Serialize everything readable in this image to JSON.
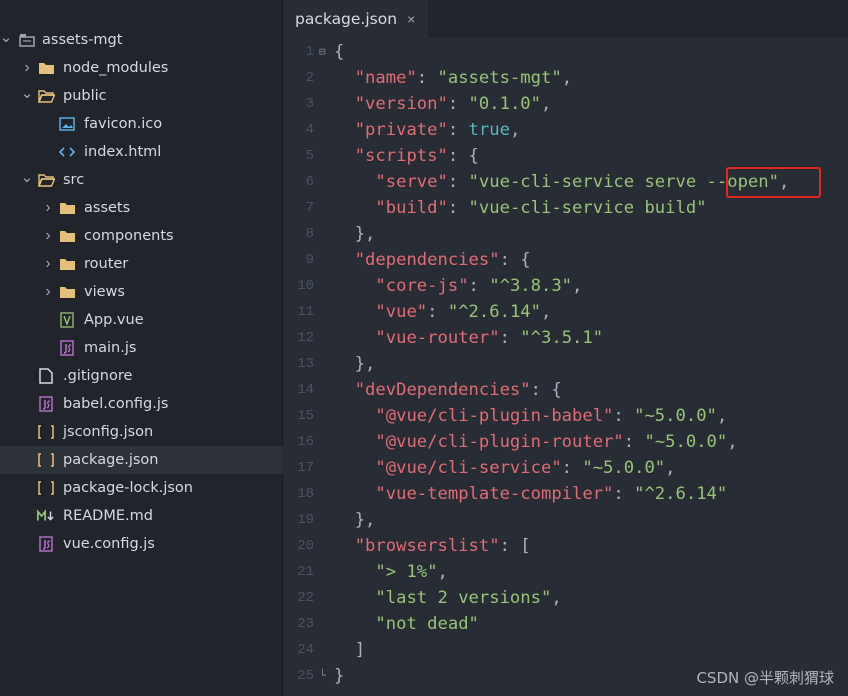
{
  "sidebar": {
    "items": [
      {
        "label": "assets-mgt",
        "icon": "project-root-icon",
        "chevron": "chevron-down-icon",
        "depth": 0,
        "type": "root"
      },
      {
        "label": "node_modules",
        "icon": "folder-icon",
        "chevron": "chevron-right-icon",
        "depth": 1,
        "type": "folder"
      },
      {
        "label": "public",
        "icon": "folder-open-icon",
        "chevron": "chevron-down-icon",
        "depth": 1,
        "type": "folder"
      },
      {
        "label": "favicon.ico",
        "icon": "image-file-icon",
        "depth": 2,
        "type": "file"
      },
      {
        "label": "index.html",
        "icon": "html-file-icon",
        "depth": 2,
        "type": "file"
      },
      {
        "label": "src",
        "icon": "folder-open-icon",
        "chevron": "chevron-down-icon",
        "depth": 1,
        "type": "folder"
      },
      {
        "label": "assets",
        "icon": "folder-icon",
        "chevron": "chevron-right-icon",
        "depth": 2,
        "type": "folder"
      },
      {
        "label": "components",
        "icon": "folder-icon",
        "chevron": "chevron-right-icon",
        "depth": 2,
        "type": "folder"
      },
      {
        "label": "router",
        "icon": "folder-icon",
        "chevron": "chevron-right-icon",
        "depth": 2,
        "type": "folder"
      },
      {
        "label": "views",
        "icon": "folder-icon",
        "chevron": "chevron-right-icon",
        "depth": 2,
        "type": "folder"
      },
      {
        "label": "App.vue",
        "icon": "vue-file-icon",
        "depth": 2,
        "type": "file"
      },
      {
        "label": "main.js",
        "icon": "js-file-icon",
        "depth": 2,
        "type": "file"
      },
      {
        "label": ".gitignore",
        "icon": "plain-file-icon",
        "depth": 1,
        "type": "file"
      },
      {
        "label": "babel.config.js",
        "icon": "js-file-icon",
        "depth": 1,
        "type": "file"
      },
      {
        "label": "jsconfig.json",
        "icon": "json-file-icon",
        "depth": 1,
        "type": "file"
      },
      {
        "label": "package.json",
        "icon": "json-file-icon",
        "depth": 1,
        "type": "file",
        "selected": true
      },
      {
        "label": "package-lock.json",
        "icon": "json-file-icon",
        "depth": 1,
        "type": "file"
      },
      {
        "label": "README.md",
        "icon": "markdown-file-icon",
        "depth": 1,
        "type": "file"
      },
      {
        "label": "vue.config.js",
        "icon": "js-file-icon",
        "depth": 1,
        "type": "file"
      }
    ]
  },
  "tab": {
    "title": "package.json",
    "close_glyph": "×"
  },
  "editor": {
    "lines": [
      {
        "n": "1",
        "fold": "⊟",
        "tokens": [
          [
            "p",
            "{"
          ]
        ]
      },
      {
        "n": "2",
        "tokens": [
          [
            "p",
            "  "
          ],
          [
            "k",
            "\"name\""
          ],
          [
            "p",
            ": "
          ],
          [
            "s",
            "\"assets-mgt\""
          ],
          [
            "p",
            ","
          ]
        ]
      },
      {
        "n": "3",
        "tokens": [
          [
            "p",
            "  "
          ],
          [
            "k",
            "\"version\""
          ],
          [
            "p",
            ": "
          ],
          [
            "s",
            "\"0.1.0\""
          ],
          [
            "p",
            ","
          ]
        ]
      },
      {
        "n": "4",
        "tokens": [
          [
            "p",
            "  "
          ],
          [
            "k",
            "\"private\""
          ],
          [
            "p",
            ": "
          ],
          [
            "b",
            "true"
          ],
          [
            "p",
            ","
          ]
        ]
      },
      {
        "n": "5",
        "tokens": [
          [
            "p",
            "  "
          ],
          [
            "k",
            "\"scripts\""
          ],
          [
            "p",
            ": {"
          ]
        ]
      },
      {
        "n": "6",
        "tokens": [
          [
            "p",
            "    "
          ],
          [
            "k",
            "\"serve\""
          ],
          [
            "p",
            ": "
          ],
          [
            "s",
            "\"vue-cli-service serve --open\""
          ],
          [
            "p",
            ","
          ]
        ]
      },
      {
        "n": "7",
        "tokens": [
          [
            "p",
            "    "
          ],
          [
            "k",
            "\"build\""
          ],
          [
            "p",
            ": "
          ],
          [
            "s",
            "\"vue-cli-service build\""
          ]
        ]
      },
      {
        "n": "8",
        "tokens": [
          [
            "p",
            "  },"
          ]
        ]
      },
      {
        "n": "9",
        "tokens": [
          [
            "p",
            "  "
          ],
          [
            "k",
            "\"dependencies\""
          ],
          [
            "p",
            ": {"
          ]
        ]
      },
      {
        "n": "10",
        "tokens": [
          [
            "p",
            "    "
          ],
          [
            "k",
            "\"core-js\""
          ],
          [
            "p",
            ": "
          ],
          [
            "s",
            "\"^3.8.3\""
          ],
          [
            "p",
            ","
          ]
        ]
      },
      {
        "n": "11",
        "tokens": [
          [
            "p",
            "    "
          ],
          [
            "k",
            "\"vue\""
          ],
          [
            "p",
            ": "
          ],
          [
            "s",
            "\"^2.6.14\""
          ],
          [
            "p",
            ","
          ]
        ]
      },
      {
        "n": "12",
        "tokens": [
          [
            "p",
            "    "
          ],
          [
            "k",
            "\"vue-router\""
          ],
          [
            "p",
            ": "
          ],
          [
            "s",
            "\"^3.5.1\""
          ]
        ]
      },
      {
        "n": "13",
        "tokens": [
          [
            "p",
            "  },"
          ]
        ]
      },
      {
        "n": "14",
        "tokens": [
          [
            "p",
            "  "
          ],
          [
            "k",
            "\"devDependencies\""
          ],
          [
            "p",
            ": {"
          ]
        ]
      },
      {
        "n": "15",
        "tokens": [
          [
            "p",
            "    "
          ],
          [
            "k",
            "\"@vue/cli-plugin-babel\""
          ],
          [
            "p",
            ": "
          ],
          [
            "s",
            "\"~5.0.0\""
          ],
          [
            "p",
            ","
          ]
        ]
      },
      {
        "n": "16",
        "tokens": [
          [
            "p",
            "    "
          ],
          [
            "k",
            "\"@vue/cli-plugin-router\""
          ],
          [
            "p",
            ": "
          ],
          [
            "s",
            "\"~5.0.0\""
          ],
          [
            "p",
            ","
          ]
        ]
      },
      {
        "n": "17",
        "tokens": [
          [
            "p",
            "    "
          ],
          [
            "k",
            "\"@vue/cli-service\""
          ],
          [
            "p",
            ": "
          ],
          [
            "s",
            "\"~5.0.0\""
          ],
          [
            "p",
            ","
          ]
        ]
      },
      {
        "n": "18",
        "tokens": [
          [
            "p",
            "    "
          ],
          [
            "k",
            "\"vue-template-compiler\""
          ],
          [
            "p",
            ": "
          ],
          [
            "s",
            "\"^2.6.14\""
          ]
        ]
      },
      {
        "n": "19",
        "tokens": [
          [
            "p",
            "  },"
          ]
        ]
      },
      {
        "n": "20",
        "tokens": [
          [
            "p",
            "  "
          ],
          [
            "k",
            "\"browserslist\""
          ],
          [
            "p",
            ": ["
          ]
        ]
      },
      {
        "n": "21",
        "tokens": [
          [
            "p",
            "    "
          ],
          [
            "s",
            "\"> 1%\""
          ],
          [
            "p",
            ","
          ]
        ]
      },
      {
        "n": "22",
        "tokens": [
          [
            "p",
            "    "
          ],
          [
            "s",
            "\"last 2 versions\""
          ],
          [
            "p",
            ","
          ]
        ]
      },
      {
        "n": "23",
        "tokens": [
          [
            "p",
            "    "
          ],
          [
            "s",
            "\"not dead\""
          ]
        ]
      },
      {
        "n": "24",
        "tokens": [
          [
            "p",
            "  ]"
          ]
        ]
      },
      {
        "n": "25",
        "fold": "└",
        "tokens": [
          [
            "p",
            "}"
          ]
        ]
      }
    ]
  },
  "annotation": {
    "highlight_color": "#e5281e",
    "highlighted_text": "--open"
  },
  "watermark": "CSDN @半颗刺猬球",
  "colors": {
    "key": "#e06c75",
    "string": "#98c379",
    "boolean": "#56b6c2",
    "folder": "#e5c07b",
    "sidebar_bg": "#21252b",
    "editor_bg": "#282c34"
  }
}
